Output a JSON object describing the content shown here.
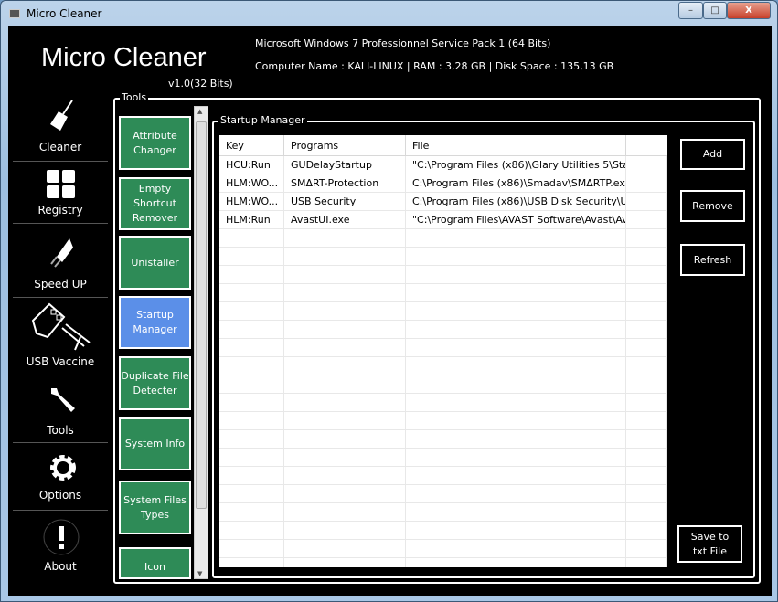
{
  "window": {
    "title": "Micro Cleaner",
    "minimize": "–",
    "maximize": "□",
    "close": "X"
  },
  "header": {
    "brand": "Micro Cleaner",
    "version": "v1.0(32 Bits)",
    "os": "Microsoft Windows 7 Professionnel  Service Pack 1 (64 Bits)",
    "system": "Computer Name : KALI-LINUX | RAM : 3,28 GB | Disk Space : 135,13 GB"
  },
  "sidebar": {
    "items": [
      {
        "label": "Cleaner",
        "icon": "broom-icon"
      },
      {
        "label": "Registry",
        "icon": "grid-icon"
      },
      {
        "label": "Speed UP",
        "icon": "rocket-icon"
      },
      {
        "label": "USB Vaccine",
        "icon": "usb-syringe-icon"
      },
      {
        "label": "Tools",
        "icon": "wrench-icon"
      },
      {
        "label": "Options",
        "icon": "gear-icon"
      },
      {
        "label": "About",
        "icon": "exclamation-icon"
      }
    ]
  },
  "tools": {
    "label": "Tools",
    "items": [
      "Attribute Changer",
      "Empty Shortcut Remover",
      "Unistaller",
      "Startup Manager",
      "Duplicate File Detecter",
      "System Info",
      "System Files Types",
      "Icon Extractor"
    ],
    "active": "Startup Manager",
    "colors": {
      "button": "#2e8b57",
      "active": "#5b8fe8"
    }
  },
  "startup": {
    "label": "Startup Manager",
    "columns": [
      "Key",
      "Programs",
      "File"
    ],
    "rows": [
      [
        "HCU:Run",
        "GUDelayStartup",
        "\"C:\\Program Files (x86)\\Glary Utilities 5\\Sta..."
      ],
      [
        "HLM:WO...",
        "SMΔRT-Protection",
        "C:\\Program Files (x86)\\Smadav\\SMΔRTP.exe..."
      ],
      [
        "HLM:WO...",
        "USB Security",
        "C:\\Program Files (x86)\\USB Disk Security\\U..."
      ],
      [
        "HLM:Run",
        "AvastUI.exe",
        "\"C:\\Program Files\\AVAST Software\\Avast\\Av..."
      ]
    ],
    "buttons": {
      "add": "Add",
      "remove": "Remove",
      "refresh": "Refresh",
      "save": "Save to txt File"
    }
  }
}
